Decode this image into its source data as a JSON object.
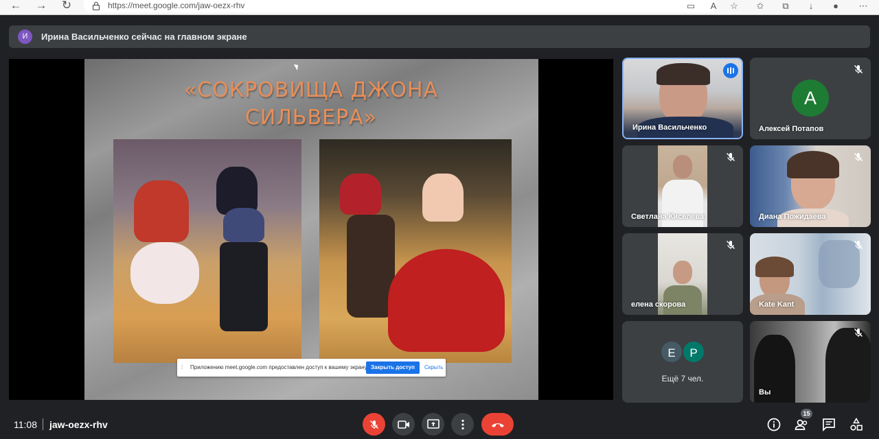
{
  "browser": {
    "url": "https://meet.google.com/jaw-oezx-rhv"
  },
  "banner": {
    "avatar_letter": "И",
    "avatar_color": "#7e57c2",
    "text": "Ирина Васильченко сейчас на главном экране"
  },
  "slide": {
    "title": "«СОКРОВИЩА ДЖОНА СИЛЬВЕРА»",
    "title_color": "#e88e59"
  },
  "share_notice": {
    "text": "Приложению meet.google.com предоставлен доступ к вашему экрану.",
    "stop_label": "Закрыть доступ",
    "hide_label": "Скрыть"
  },
  "participants": [
    {
      "name": "Ирина Васильченко",
      "speaking": true
    },
    {
      "name": "Алексей Потапов",
      "avatar_letter": "А",
      "avatar_color": "#1e7b34",
      "muted": true
    },
    {
      "name": "Светлана Киселева",
      "muted": true
    },
    {
      "name": "Диана Пожидаева",
      "muted": true
    },
    {
      "name": "елена скорова",
      "muted": true
    },
    {
      "name": "Kate Kant",
      "muted": true
    },
    {
      "name": "Вы",
      "muted": true
    }
  ],
  "more_tile": {
    "avatars": [
      {
        "letter": "Е",
        "color": "#455a64"
      },
      {
        "letter": "Р",
        "color": "#00796b"
      }
    ],
    "label": "Ещё 7 чел."
  },
  "bottom_bar": {
    "time": "11:08",
    "meeting_code": "jaw-oezx-rhv",
    "participant_count": "15",
    "accent_red": "#ea4335"
  }
}
